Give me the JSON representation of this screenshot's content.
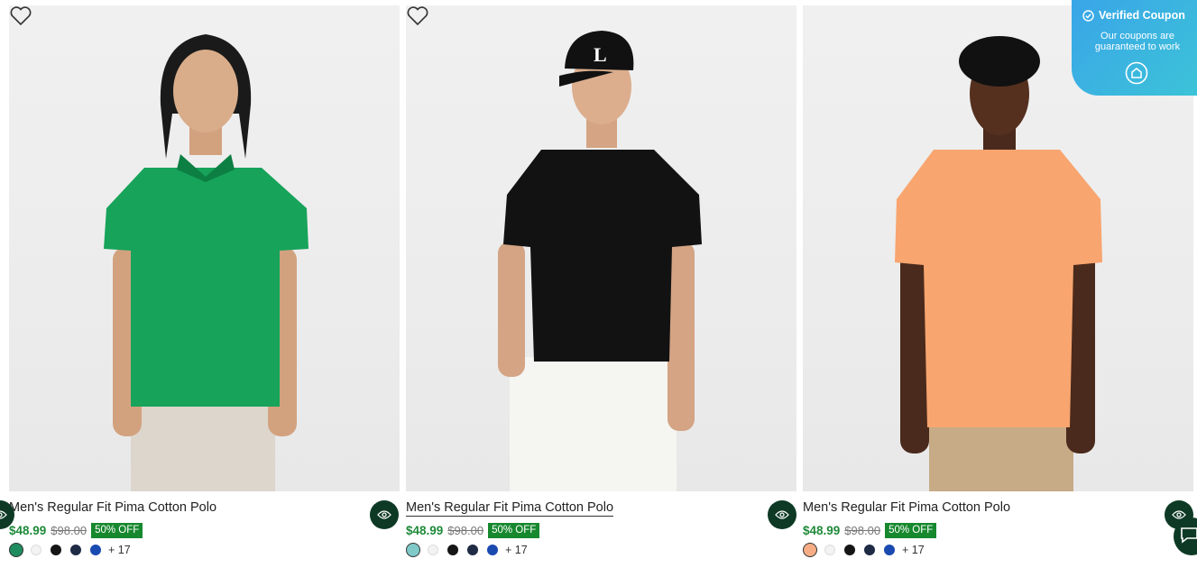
{
  "products": [
    {
      "title": "Men's Regular Fit Pima Cotton Polo",
      "price": "$48.99",
      "original_price": "$98.00",
      "discount": "50% OFF",
      "more_colors": "+ 17",
      "shirt_color": "#17a35a",
      "swatches": [
        "#1e8c5e",
        "#f3f3f3",
        "#151515",
        "#1f2a44",
        "#1a4ab0"
      ]
    },
    {
      "title": "Men's Regular Fit Pima Cotton Polo",
      "price": "$48.99",
      "original_price": "$98.00",
      "discount": "50% OFF",
      "more_colors": "+ 17",
      "shirt_color": "#121212",
      "swatches": [
        "#7fc9c9",
        "#f3f3f3",
        "#151515",
        "#1f2a44",
        "#1a4ab0"
      ]
    },
    {
      "title": "Men's Regular Fit Pima Cotton Polo",
      "price": "$48.99",
      "original_price": "$98.00",
      "discount": "50% OFF",
      "more_colors": "+ 17",
      "shirt_color": "#f8a56f",
      "swatches": [
        "#f6ad85",
        "#f3f3f3",
        "#151515",
        "#1f2a44",
        "#1a4ab0"
      ]
    }
  ],
  "coupon": {
    "title": "Verified Coupon",
    "subtitle": "Our coupons are guaranteed to work"
  },
  "icons": {
    "wishlist": "heart-icon",
    "quick_view": "eye-icon",
    "coupon_badge": "verified-check-icon",
    "coupon_logo": "coupon-tag-icon",
    "chat": "chat-icon"
  }
}
